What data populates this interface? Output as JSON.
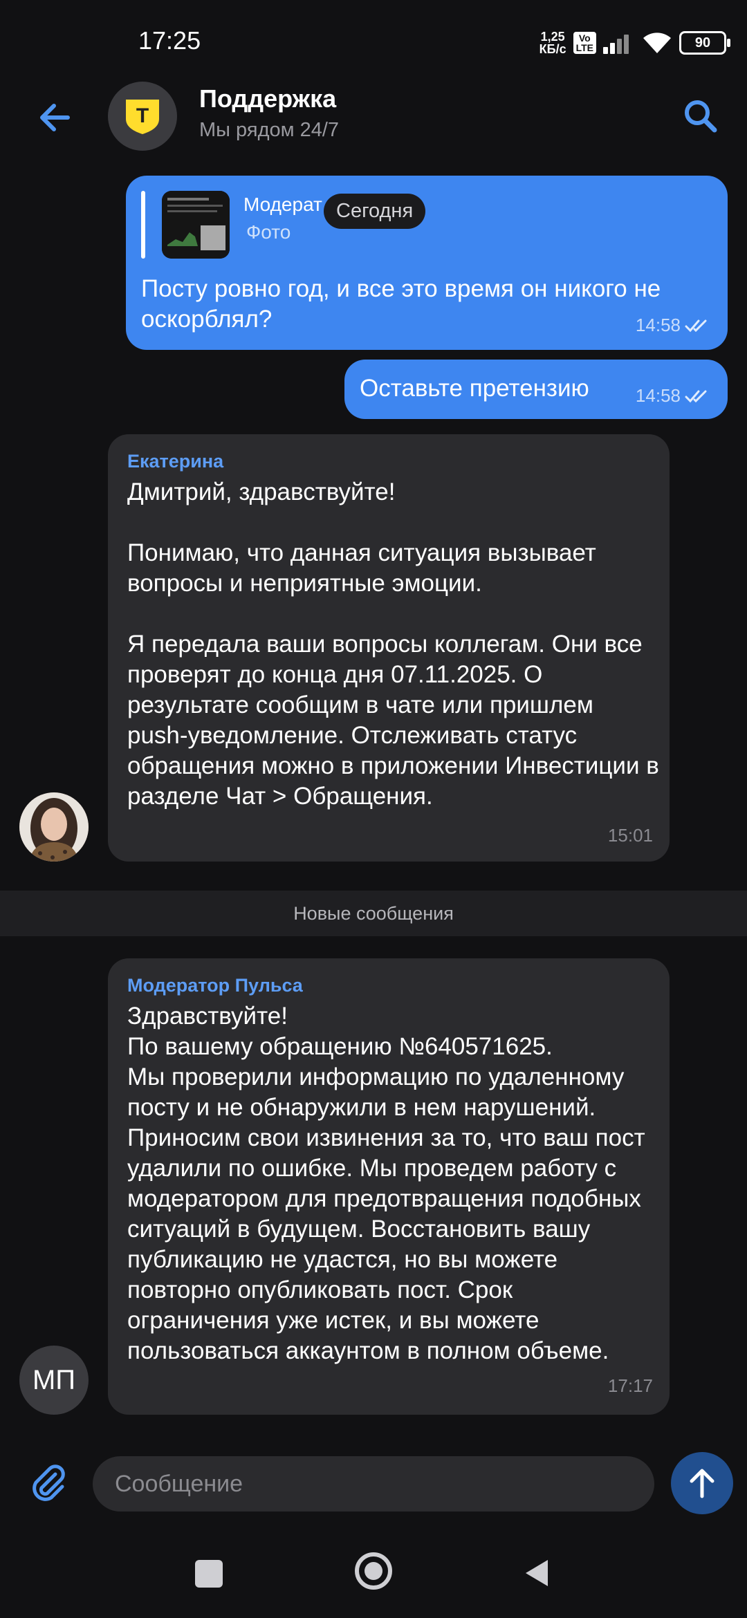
{
  "status_bar": {
    "time": "17:25",
    "net_speed_value": "1,25",
    "net_speed_unit": "КБ/с",
    "volte_top": "Vo",
    "volte_bottom": "LTE",
    "battery": "90"
  },
  "header": {
    "title": "Поддержка",
    "subtitle": "Мы рядом 24/7",
    "avatar_icon": "tinkoff-shield-logo",
    "avatar_letter": "T"
  },
  "date_pill": "Сегодня",
  "messages": [
    {
      "reply_to": {
        "author": "Модерат",
        "type": "Фото"
      },
      "text": "Посту ровно год, и все это время он никого не оскорблял?",
      "time": "14:58"
    },
    {
      "text": "Оставьте претензию",
      "time": "14:58"
    },
    {
      "sender": "Екатерина",
      "text": "Дмитрий, здравствуйте!\n\nПонимаю, что данная ситуация вызывает вопросы и неприятные эмоции.\n\nЯ передала ваши вопросы коллегам. Они все проверят до конца дня 07.11.2025. О результате сообщим в чате или пришлем push-уведомление. Отслеживать статус обращения можно в приложении Инвестиции в разделе Чат > Обращения.",
      "time": "15:01"
    },
    {
      "sender": "Модератор Пульса",
      "initials": "МП",
      "text": "Здравствуйте!\nПо вашему обращению №640571625.\nМы проверили информацию по удаленному посту и не обнаружили в нем нарушений. Приносим свои извинения за то, что ваш пост удалили по ошибке. Мы проведем работу с модератором для предотвращения подобных ситуаций в будущем. Восстановить вашу публикацию не удастся, но вы можете повторно опубликовать пост. Срок ограничения уже истек, и вы можете пользоваться аккаунтом в полном объеме.",
      "time": "17:17"
    }
  ],
  "divider_label": "Новые сообщения",
  "composer": {
    "placeholder": "Сообщение"
  },
  "colors": {
    "background": "#111113",
    "bubble_out": "#3e86f0",
    "bubble_in": "#2b2b2e",
    "accent": "#5d9df5",
    "logo_yellow": "#ffdd2d"
  }
}
